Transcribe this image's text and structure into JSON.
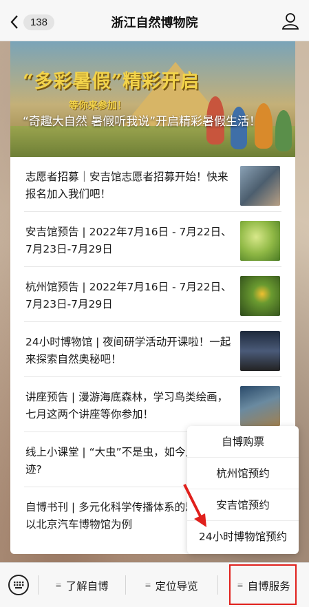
{
  "nav": {
    "back_count": "138",
    "title": "浙江自然博物院"
  },
  "banner": {
    "headline": "“多彩暑假”精彩开启",
    "subheadline": "等你来参加！",
    "caption": "“奇趣大自然 暑假听我说”开启精彩暑假生活！"
  },
  "articles": [
    {
      "title": "志愿者招募｜安吉馆志愿者招募开始！快来报名加入我们吧！"
    },
    {
      "title": "安吉馆预告 | 2022年7月16日 - 7月22日、7月23日-7月29日"
    },
    {
      "title": "杭州馆预告 | 2022年7月16日 - 7月22日、7月23日-7月29日"
    },
    {
      "title": "24小时博物馆 | 夜间研学活动开课啦！一起来探索自然奥秘吧！"
    },
    {
      "title": "讲座预告 | 漫游海底森林，学习鸟类绘画，七月这两个讲座等你参加！"
    },
    {
      "title": "线上小课堂 | “大虫”不是虫，如今几近乎绝迹?"
    },
    {
      "title": "自博书刊 | 多元化科学传播体系的思考——以北京汽车博物馆为例"
    }
  ],
  "popup_menu": {
    "items": [
      "自博购票",
      "杭州馆预约",
      "安吉馆预约",
      "24小时博物馆预约"
    ]
  },
  "tabbar": {
    "tabs": [
      "了解自博",
      "定位导览",
      "自博服务"
    ],
    "highlighted_tab": "自博服务"
  },
  "colors": {
    "annotation": "#e0201c",
    "banner_text": "#f2d34a"
  }
}
